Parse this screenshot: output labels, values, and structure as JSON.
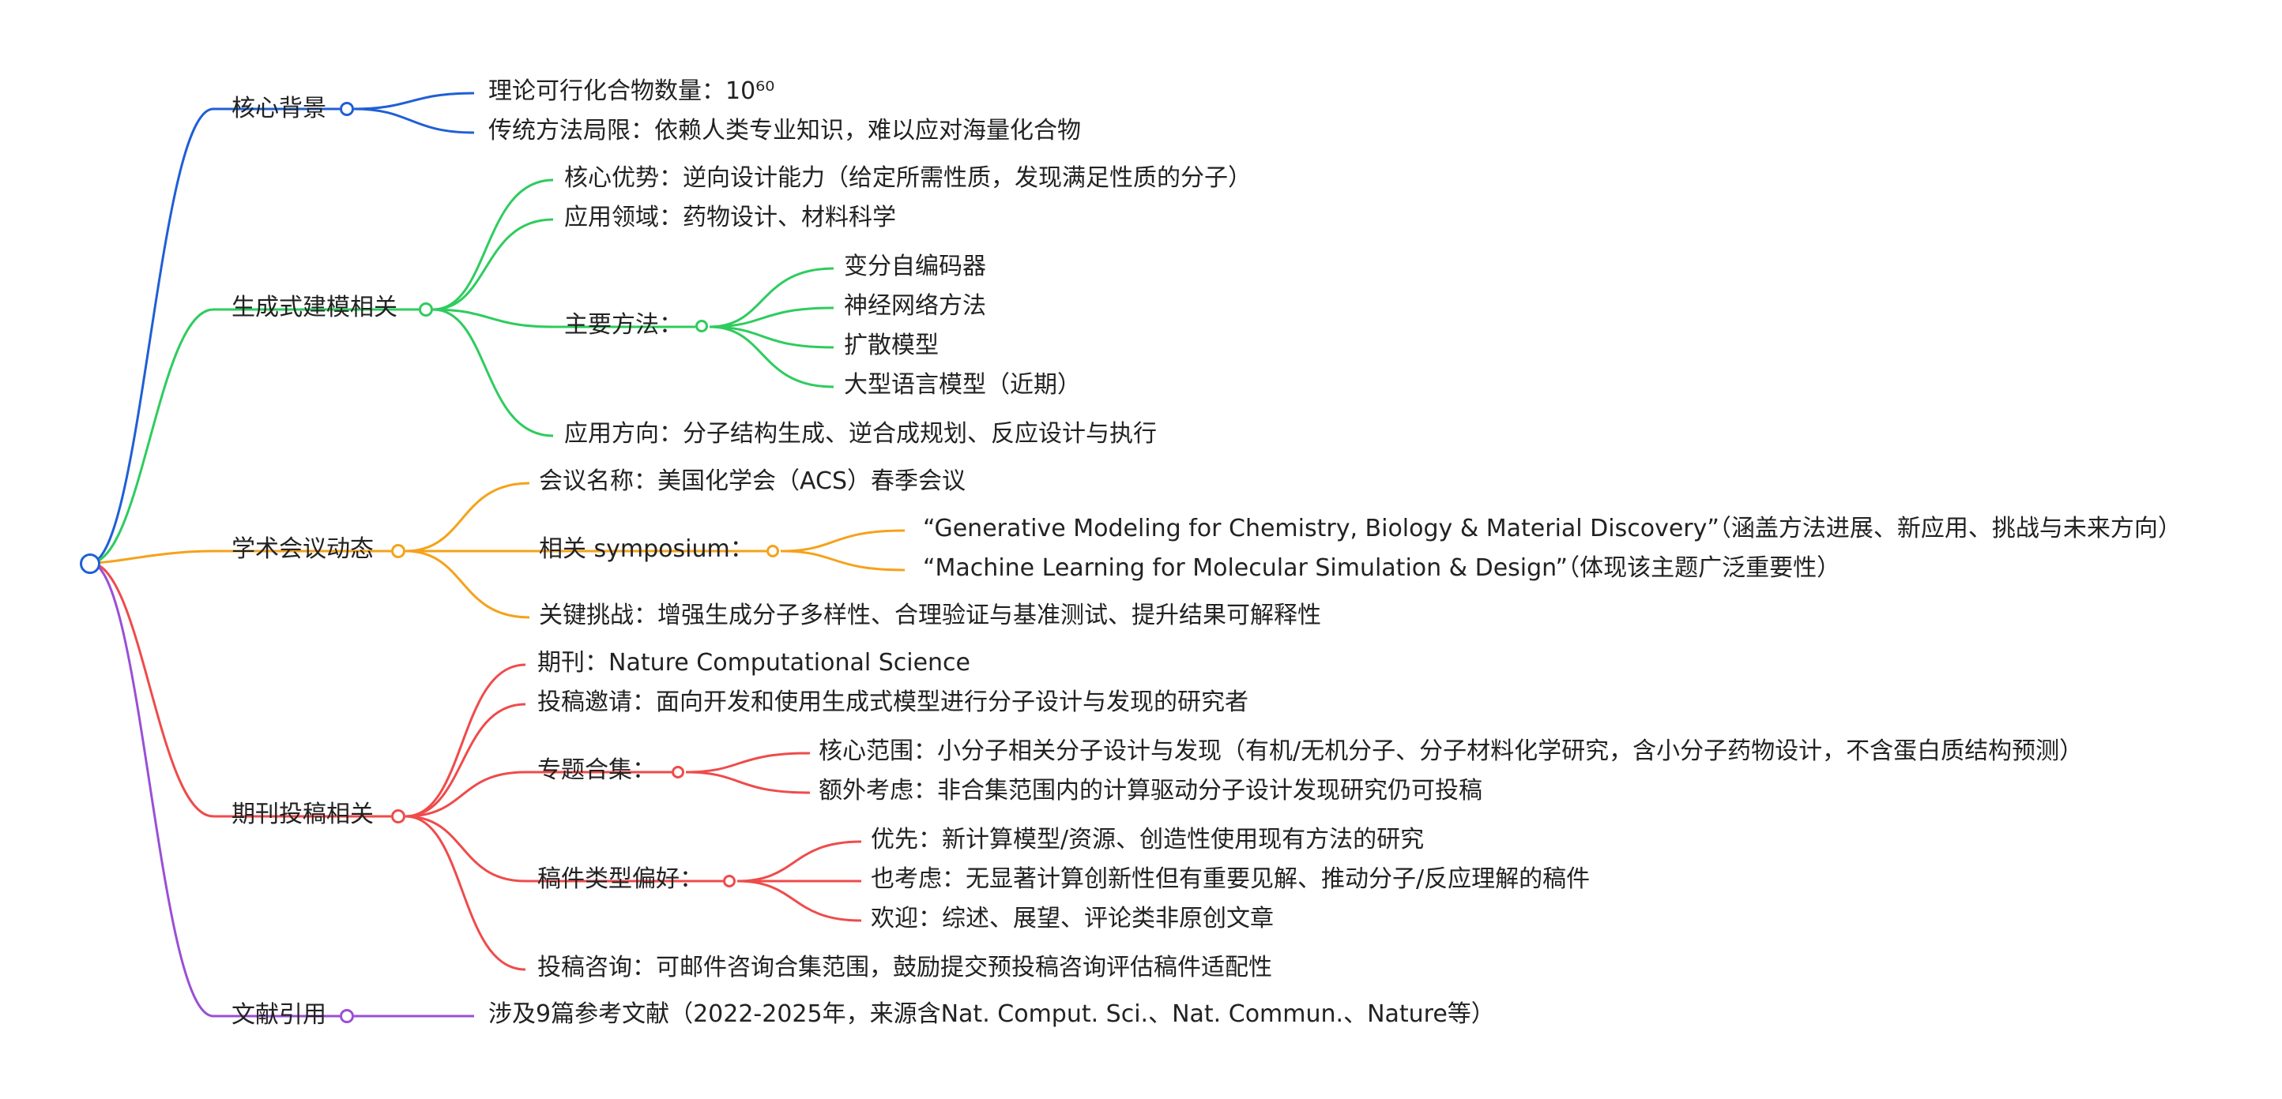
{
  "colors": {
    "blue": "#1f5fd6",
    "green": "#2ecc5e",
    "orange": "#f5a21a",
    "red": "#ef4b4b",
    "purple": "#9a4fd6"
  },
  "root": {
    "icon": "root-node-icon"
  },
  "branches": {
    "b1": {
      "label": "核心背景",
      "c1": "理论可行化合物数量：10⁶⁰",
      "c2": "传统方法局限：依赖人类专业知识，难以应对海量化合物"
    },
    "b2": {
      "label": "生成式建模相关",
      "c1": "核心优势：逆向设计能力（给定所需性质，发现满足性质的分子）",
      "c2": "应用领域：药物设计、材料科学",
      "c3": "主要方法：",
      "c3_items": [
        "变分自编码器",
        "神经网络方法",
        "扩散模型",
        "大型语言模型（近期）"
      ],
      "c4": "应用方向：分子结构生成、逆合成规划、反应设计与执行"
    },
    "b3": {
      "label": "学术会议动态",
      "c1": "会议名称：美国化学会（ACS）春季会议",
      "c2": "相关 symposium：",
      "c2_items": [
        "“Generative Modeling for Chemistry, Biology & Material Discovery”（涵盖方法进展、新应用、挑战与未来方向）",
        "“Machine Learning for Molecular Simulation & Design”（体现该主题广泛重要性）"
      ],
      "c3": "关键挑战：增强生成分子多样性、合理验证与基准测试、提升结果可解释性"
    },
    "b4": {
      "label": "期刊投稿相关",
      "c1": "期刊：Nature Computational Science",
      "c2": "投稿邀请：面向开发和使用生成式模型进行分子设计与发现的研究者",
      "c3": "专题合集：",
      "c3_items": [
        "核心范围：小分子相关分子设计与发现（有机/无机分子、分子材料化学研究，含小分子药物设计，不含蛋白质结构预测）",
        "额外考虑：非合集范围内的计算驱动分子设计发现研究仍可投稿"
      ],
      "c4": "稿件类型偏好：",
      "c4_items": [
        "优先：新计算模型/资源、创造性使用现有方法的研究",
        "也考虑：无显著计算创新性但有重要见解、推动分子/反应理解的稿件",
        "欢迎：综述、展望、评论类非原创文章"
      ],
      "c5": "投稿咨询：可邮件咨询合集范围，鼓励提交预投稿咨询评估稿件适配性"
    },
    "b5": {
      "label": "文献引用",
      "c1": "涉及9篇参考文献（2022-2025年，来源含Nat. Comput. Sci.、Nat. Commun.、Nature等）"
    }
  }
}
